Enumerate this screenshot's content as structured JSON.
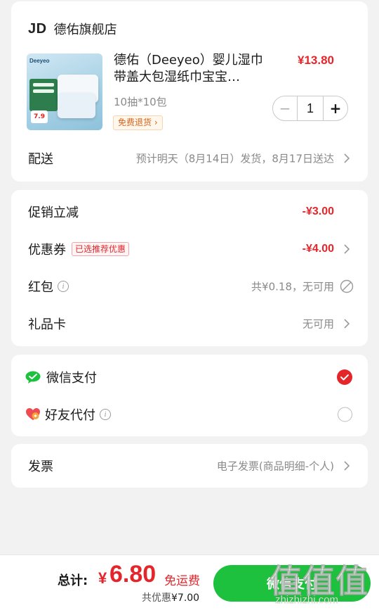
{
  "store": {
    "logo": "JD",
    "name": "德佑旗舰店"
  },
  "product": {
    "image_brand": "Deeyeo",
    "image_price": "7.9",
    "title": "德佑（Deeyeo）婴儿湿巾带盖大包湿纸巾宝宝…",
    "price": "¥13.80",
    "spec": "10抽*10包",
    "return_badge": "免费退货 ›",
    "quantity": "1",
    "minus_label": "−",
    "plus_label": "+"
  },
  "delivery": {
    "label": "配送",
    "value": "预计明天（8月14日）发货，8月17日送达"
  },
  "discounts": {
    "promo": {
      "label": "促销立减",
      "value": "-¥3.00"
    },
    "coupon": {
      "label": "优惠券",
      "tag": "已选推荐优惠",
      "value": "-¥4.00"
    },
    "redpacket": {
      "label": "红包",
      "value": "共¥0.18，无可用"
    },
    "giftcard": {
      "label": "礼品卡",
      "value": "无可用"
    }
  },
  "payment": {
    "wechat": {
      "label": "微信支付",
      "selected": true
    },
    "friend": {
      "label": "好友代付",
      "selected": false
    }
  },
  "invoice": {
    "label": "发票",
    "value": "电子发票(商品明细-个人)"
  },
  "footer": {
    "total_label": "总计:",
    "currency": "¥",
    "amount": "6.80",
    "free_shipping": "免运费",
    "saving_prefix": "共优惠",
    "saving_amount": "¥7.00",
    "pay_button": "微信支付"
  },
  "watermark": {
    "big": "值值值",
    "small": "zhizhizhi.com"
  },
  "colors": {
    "accent_red": "#e4262b",
    "wechat_green": "#1ec13e",
    "background": "#f2f2f2"
  }
}
